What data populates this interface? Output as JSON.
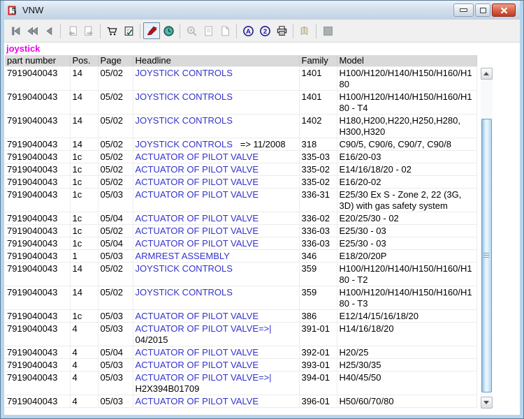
{
  "window": {
    "title": "VNW"
  },
  "colors": {
    "link_blue": "#3333cc",
    "search_term_magenta": "#f000f0",
    "header_gray": "#dadada",
    "close_button_red": "#bf3a22",
    "scroll_thumb_blue": "#bcdcf2",
    "title_gradient_top": "#eaf1f9"
  },
  "search_term": "joystick",
  "toolbar": {
    "buttons": [
      {
        "name": "first-record-button",
        "icon": "first-record-icon"
      },
      {
        "name": "fast-back-button",
        "icon": "fast-back-icon"
      },
      {
        "name": "previous-button",
        "icon": "previous-icon",
        "sep_after": true
      },
      {
        "name": "page-back-button",
        "icon": "page-back-icon",
        "state": "disabled"
      },
      {
        "name": "page-forward-button",
        "icon": "page-forward-icon",
        "state": "disabled",
        "sep_after": true
      },
      {
        "name": "cart-button",
        "icon": "cart-icon"
      },
      {
        "name": "checklist-button",
        "icon": "checklist-icon",
        "sep_after": true
      },
      {
        "name": "no-edit-toggle",
        "icon": "pen-slash-icon",
        "state": "pressed"
      },
      {
        "name": "history-button",
        "icon": "clock-icon",
        "sep_after": true
      },
      {
        "name": "zoom-button",
        "icon": "magnifier-icon",
        "state": "disabled"
      },
      {
        "name": "page-view-button",
        "icon": "document-icon",
        "state": "disabled"
      },
      {
        "name": "page-preview-button",
        "icon": "document-folded-icon",
        "state": "disabled",
        "sep_after": true
      },
      {
        "name": "sort-alpha-button",
        "icon": "circled-a-icon"
      },
      {
        "name": "sort-numeric-button",
        "icon": "circled-2-icon"
      },
      {
        "name": "print-button",
        "icon": "printer-icon",
        "sep_after": true
      },
      {
        "name": "notes-button",
        "icon": "notes-icon",
        "state": "disabled",
        "sep_after": true
      },
      {
        "name": "stop-button",
        "icon": "gray-square-icon",
        "state": "disabled"
      }
    ]
  },
  "table": {
    "columns": [
      "part number",
      "Pos.",
      "Page",
      "Headline",
      "Family",
      "Model"
    ],
    "rows": [
      {
        "part": "7919040043",
        "pos": "14",
        "page": "05/02",
        "headline": "JOYSTICK CONTROLS",
        "note": "",
        "note_break": false,
        "family": "1401",
        "model": "H100/H120/H140/H150/H160/H180"
      },
      {
        "part": "7919040043",
        "pos": "14",
        "page": "05/02",
        "headline": "JOYSTICK CONTROLS",
        "note": "",
        "note_break": false,
        "family": "1401",
        "model": "H100/H120/H140/H150/H160/H180 - T4"
      },
      {
        "part": "7919040043",
        "pos": "14",
        "page": "05/02",
        "headline": "JOYSTICK CONTROLS",
        "note": "",
        "note_break": false,
        "family": "1402",
        "model": "H180,H200,H220,H250,H280, H300,H320"
      },
      {
        "part": "7919040043",
        "pos": "14",
        "page": "05/02",
        "headline": "JOYSTICK CONTROLS",
        "note": "   => 11/2008",
        "note_break": false,
        "family": "318",
        "model": "C90/5, C90/6, C90/7, C90/8"
      },
      {
        "part": "7919040043",
        "pos": "1c",
        "page": "05/02",
        "headline": "ACTUATOR OF PILOT VALVE",
        "note": "",
        "note_break": false,
        "family": "335-03",
        "model": "E16/20-03"
      },
      {
        "part": "7919040043",
        "pos": "1c",
        "page": "05/02",
        "headline": "ACTUATOR OF PILOT VALVE",
        "note": "",
        "note_break": false,
        "family": "335-02",
        "model": "E14/16/18/20 - 02"
      },
      {
        "part": "7919040043",
        "pos": "1c",
        "page": "05/02",
        "headline": "ACTUATOR OF PILOT VALVE",
        "note": "",
        "note_break": false,
        "family": "335-02",
        "model": "E16/20-02"
      },
      {
        "part": "7919040043",
        "pos": "1c",
        "page": "05/03",
        "headline": "ACTUATOR OF PILOT VALVE",
        "note": "",
        "note_break": false,
        "family": "336-31",
        "model": "E25/30 Ex S - Zone 2, 22 (3G, 3D) with gas safety system"
      },
      {
        "part": "7919040043",
        "pos": "1c",
        "page": "05/04",
        "headline": "ACTUATOR OF PILOT VALVE",
        "note": "",
        "note_break": false,
        "family": "336-02",
        "model": "E20/25/30 - 02"
      },
      {
        "part": "7919040043",
        "pos": "1c",
        "page": "05/02",
        "headline": "ACTUATOR OF PILOT VALVE",
        "note": "",
        "note_break": false,
        "family": "336-03",
        "model": "E25/30 - 03"
      },
      {
        "part": "7919040043",
        "pos": "1c",
        "page": "05/04",
        "headline": "ACTUATOR OF PILOT VALVE",
        "note": "",
        "note_break": false,
        "family": "336-03",
        "model": "E25/30 - 03"
      },
      {
        "part": "7919040043",
        "pos": "1",
        "page": "05/03",
        "headline": "ARMREST ASSEMBLY",
        "note": "",
        "note_break": false,
        "family": "346",
        "model": "E18/20/20P"
      },
      {
        "part": "7919040043",
        "pos": "14",
        "page": "05/02",
        "headline": "JOYSTICK CONTROLS",
        "note": "",
        "note_break": false,
        "family": "359",
        "model": "H100/H120/H140/H150/H160/H180 - T2"
      },
      {
        "part": "7919040043",
        "pos": "14",
        "page": "05/02",
        "headline": "JOYSTICK CONTROLS",
        "note": "",
        "note_break": false,
        "family": "359",
        "model": "H100/H120/H140/H150/H160/H180 - T3"
      },
      {
        "part": "7919040043",
        "pos": "1c",
        "page": "05/03",
        "headline": "ACTUATOR OF PILOT VALVE",
        "note": "",
        "note_break": false,
        "family": "386",
        "model": "E12/14/15/16/18/20"
      },
      {
        "part": "7919040043",
        "pos": "4",
        "page": "05/03",
        "headline": "ACTUATOR OF PILOT VALVE=>|",
        "note": "04/2015",
        "note_break": true,
        "family": "391-01",
        "model": "H14/16/18/20"
      },
      {
        "part": "7919040043",
        "pos": "4",
        "page": "05/04",
        "headline": "ACTUATOR OF PILOT VALVE",
        "note": "",
        "note_break": false,
        "family": "392-01",
        "model": "H20/25"
      },
      {
        "part": "7919040043",
        "pos": "4",
        "page": "05/03",
        "headline": "ACTUATOR OF PILOT VALVE",
        "note": "",
        "note_break": false,
        "family": "393-01",
        "model": "H25/30/35"
      },
      {
        "part": "7919040043",
        "pos": "4",
        "page": "05/03",
        "headline": "ACTUATOR OF PILOT VALVE=>|",
        "note": "H2X394B01709",
        "note_break": true,
        "family": "394-01",
        "model": "H40/45/50"
      },
      {
        "part": "7919040043",
        "pos": "4",
        "page": "05/03",
        "headline": "ACTUATOR OF PILOT VALVE",
        "note": "",
        "note_break": false,
        "family": "396-01",
        "model": "H50/60/70/80"
      }
    ]
  }
}
